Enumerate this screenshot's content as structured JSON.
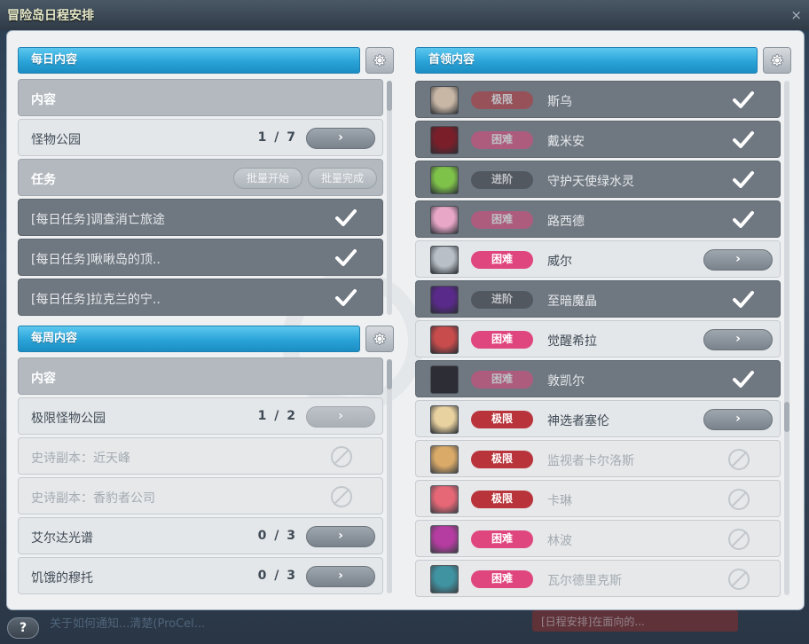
{
  "window": {
    "title": "冒险岛日程安排",
    "close": "×",
    "help": "?"
  },
  "background": {
    "bottom_text": "关于如何通知...清楚(ProCel...",
    "bottom_pill": "[日程安排]在面向的..."
  },
  "daily": {
    "header": "每日内容",
    "header_row": "内容",
    "rows": [
      {
        "label": "怪物公园",
        "count": "1 / 7",
        "state": "normal",
        "action": "go"
      },
      {
        "label": "任务",
        "state": "header",
        "buttons": [
          "批量开始",
          "批量完成"
        ]
      },
      {
        "label": "[每日任务]调查消亡旅途",
        "state": "done"
      },
      {
        "label": "[每日任务]啾啾岛的顶..",
        "state": "done"
      },
      {
        "label": "[每日任务]拉克兰的宁..",
        "state": "done"
      }
    ]
  },
  "weekly": {
    "header": "每周内容",
    "header_row": "内容",
    "rows": [
      {
        "label": "极限怪物公园",
        "count": "1 / 2",
        "state": "normal",
        "action": "go-faint"
      },
      {
        "label": "史诗副本：近天峰",
        "state": "disabled"
      },
      {
        "label": "史诗副本：香豹者公司",
        "state": "disabled"
      },
      {
        "label": "艾尔达光谱",
        "count": "0 / 3",
        "state": "normal",
        "action": "go"
      },
      {
        "label": "饥饿的穆托",
        "count": "0 / 3",
        "state": "normal",
        "action": "go"
      }
    ]
  },
  "boss": {
    "header": "首领内容",
    "rows": [
      {
        "name": "斯乌",
        "difficulty": "极限",
        "diff_class": "extreme",
        "state": "done",
        "avatar_color": "#c9b7a6"
      },
      {
        "name": "戴米安",
        "difficulty": "困难",
        "diff_class": "hard",
        "state": "done",
        "avatar_color": "#7a1f2a"
      },
      {
        "name": "守护天使绿水灵",
        "difficulty": "进阶",
        "diff_class": "advanced",
        "state": "done",
        "avatar_color": "#7fc24a"
      },
      {
        "name": "路西德",
        "difficulty": "困难",
        "diff_class": "hard",
        "state": "done",
        "avatar_color": "#e9a7c8"
      },
      {
        "name": "威尔",
        "difficulty": "困难",
        "diff_class": "hard",
        "state": "normal",
        "avatar_color": "#b9bfc7"
      },
      {
        "name": "至暗魔晶",
        "difficulty": "进阶",
        "diff_class": "advanced",
        "state": "done",
        "avatar_color": "#5a2a8a"
      },
      {
        "name": "觉醒希拉",
        "difficulty": "困难",
        "diff_class": "hard",
        "state": "normal",
        "avatar_color": "#c84c4c"
      },
      {
        "name": "敦凯尔",
        "difficulty": "困难",
        "diff_class": "hard",
        "state": "done",
        "avatar_color": "#2d2d35"
      },
      {
        "name": "神选者塞伦",
        "difficulty": "极限",
        "diff_class": "extreme",
        "state": "normal",
        "avatar_color": "#e8d2a0"
      },
      {
        "name": "监视者卡尔洛斯",
        "difficulty": "极限",
        "diff_class": "extreme",
        "state": "disabled",
        "avatar_color": "#d9a45a"
      },
      {
        "name": "卡琳",
        "difficulty": "极限",
        "diff_class": "extreme",
        "state": "disabled",
        "avatar_color": "#e65a6a"
      },
      {
        "name": "林波",
        "difficulty": "困难",
        "diff_class": "hard",
        "state": "disabled",
        "avatar_color": "#b02a9a"
      },
      {
        "name": "瓦尔德里克斯",
        "difficulty": "困难",
        "diff_class": "hard",
        "state": "disabled",
        "avatar_color": "#2f8a9a"
      }
    ]
  },
  "go_glyph": "›",
  "colors": {
    "accent_blue": "#2aa3d8",
    "done_row": "#6f7780",
    "hard_badge": "#e0467e",
    "extreme_badge": "#b8343a",
    "advanced_badge": "#3b3f45"
  }
}
